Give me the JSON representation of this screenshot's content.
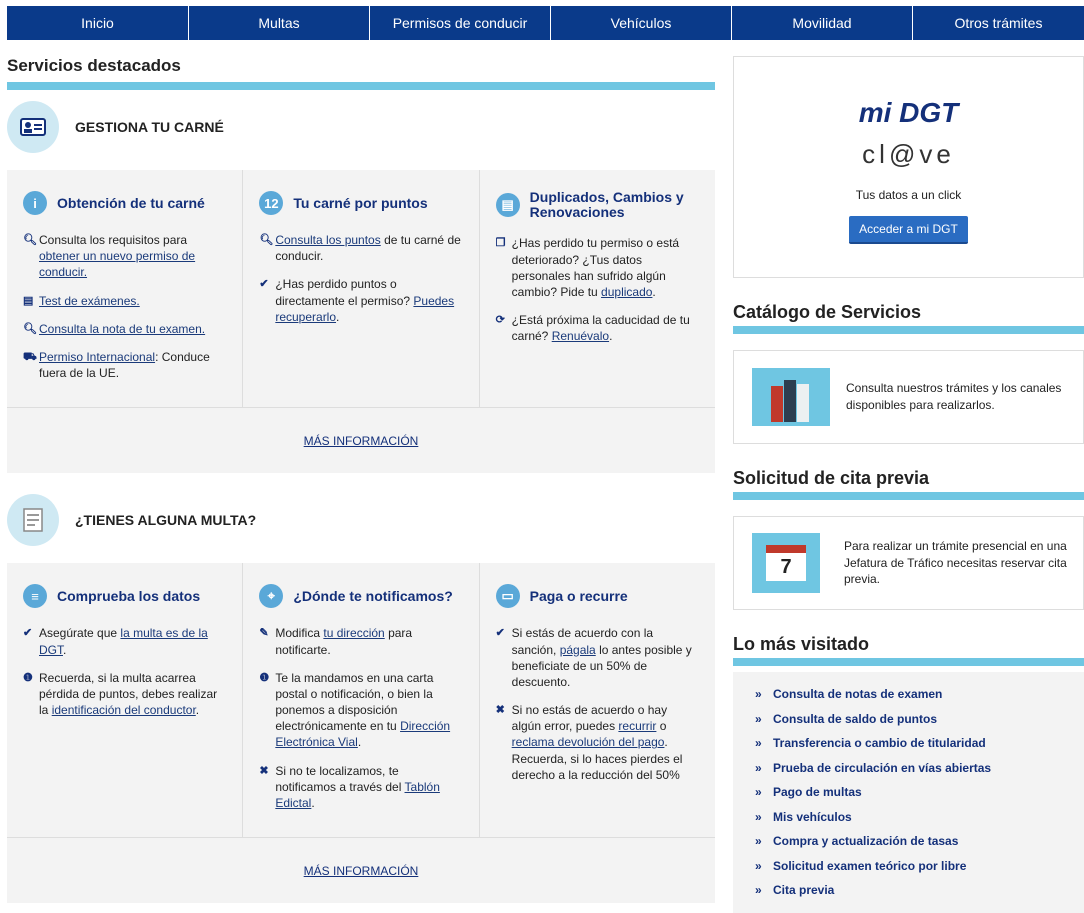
{
  "nav": {
    "items": [
      "Inicio",
      "Multas",
      "Permisos de conducir",
      "Vehículos",
      "Movilidad",
      "Otros trámites"
    ]
  },
  "left": {
    "featured_title": "Servicios destacados",
    "carne": {
      "title": "GESTIONA TU CARNÉ",
      "col1": {
        "title": "Obtención de tu carné",
        "items": [
          {
            "text": "Consulta los requisitos para ",
            "link": "obtener un nuevo permiso de conducir."
          },
          {
            "text": "",
            "link": "Test de exámenes."
          },
          {
            "text": "",
            "link": "Consulta la nota de tu examen."
          },
          {
            "text": ": Conduce fuera de la UE.",
            "link": "Permiso Internacional"
          }
        ]
      },
      "col2": {
        "title": "Tu carné por puntos",
        "items": [
          {
            "link": "Consulta los puntos",
            "text": " de tu carné de conducir."
          },
          {
            "text": "¿Has perdido puntos o directamente el permiso? ",
            "link": "Puedes recuperarlo",
            "tail": "."
          }
        ]
      },
      "col3": {
        "title": "Duplicados, Cambios y Renovaciones",
        "items": [
          {
            "text": "¿Has perdido tu permiso o está deteriorado? ¿Tus datos personales han sufrido algún cambio? Pide tu ",
            "link": "duplicado",
            "tail": "."
          },
          {
            "text": "¿Está próxima la caducidad de tu carné? ",
            "link": "Renuévalo",
            "tail": "."
          }
        ]
      },
      "more": "MÁS INFORMACIÓN"
    },
    "multa": {
      "title": "¿TIENES ALGUNA MULTA?",
      "col1": {
        "title": "Comprueba los datos",
        "items": [
          {
            "text": "Asegúrate que ",
            "link": "la multa es de la DGT",
            "tail": "."
          },
          {
            "text": "Recuerda, si la multa acarrea pérdida de puntos, debes realizar la ",
            "link": "identificación del conductor",
            "tail": "."
          }
        ]
      },
      "col2": {
        "title": "¿Dónde te notificamos?",
        "items": [
          {
            "text": "Modifica ",
            "link": "tu dirección",
            "tail": " para notificarte."
          },
          {
            "text": "Te la mandamos en una carta postal o notificación, o bien la ponemos a disposición electrónicamente en tu ",
            "link": "Dirección Electrónica Vial",
            "tail": "."
          },
          {
            "text": "Si no te localizamos, te notificamos a través del ",
            "link": "Tablón Edictal",
            "tail": "."
          }
        ]
      },
      "col3": {
        "title": "Paga o recurre",
        "items": [
          {
            "text": "Si estás de acuerdo con la sanción, ",
            "link": "págala",
            "tail": " lo antes posible y beneficiate de un 50% de descuento."
          },
          {
            "text": "Si no estás de acuerdo o hay algún error, puedes ",
            "link": "recurrir",
            "mid": " o ",
            "link2": "reclama devolución del pago",
            "tail": ". Recuerda, si lo haces pierdes el derecho a la reducción del 50%"
          }
        ]
      },
      "more": "MÁS INFORMACIÓN"
    }
  },
  "right": {
    "midgt": {
      "logo1": "mi DGT",
      "logo2": "cl@ve",
      "caption": "Tus datos a un click",
      "button": "Acceder a mi DGT"
    },
    "catalogo": {
      "title": "Catálogo de Servicios",
      "text": "Consulta nuestros trámites y los canales disponibles para realizarlos."
    },
    "cita": {
      "title": "Solicitud de cita previa",
      "text": "Para realizar un trámite presencial en una Jefatura de Tráfico necesitas reservar cita previa.",
      "day": "7"
    },
    "visitado": {
      "title": "Lo más visitado",
      "items": [
        "Consulta de notas de examen",
        "Consulta de saldo de puntos",
        "Transferencia o cambio de titularidad",
        "Prueba de circulación en vías abiertas",
        "Pago de multas",
        "Mis vehículos",
        "Compra y actualización de tasas",
        "Solicitud examen teórico por libre",
        "Cita previa"
      ]
    }
  },
  "colors": {
    "nav": "#0a3a8a",
    "accent_bar": "#6fc6e2",
    "link": "#14307a",
    "button": "#2a6cc2"
  }
}
